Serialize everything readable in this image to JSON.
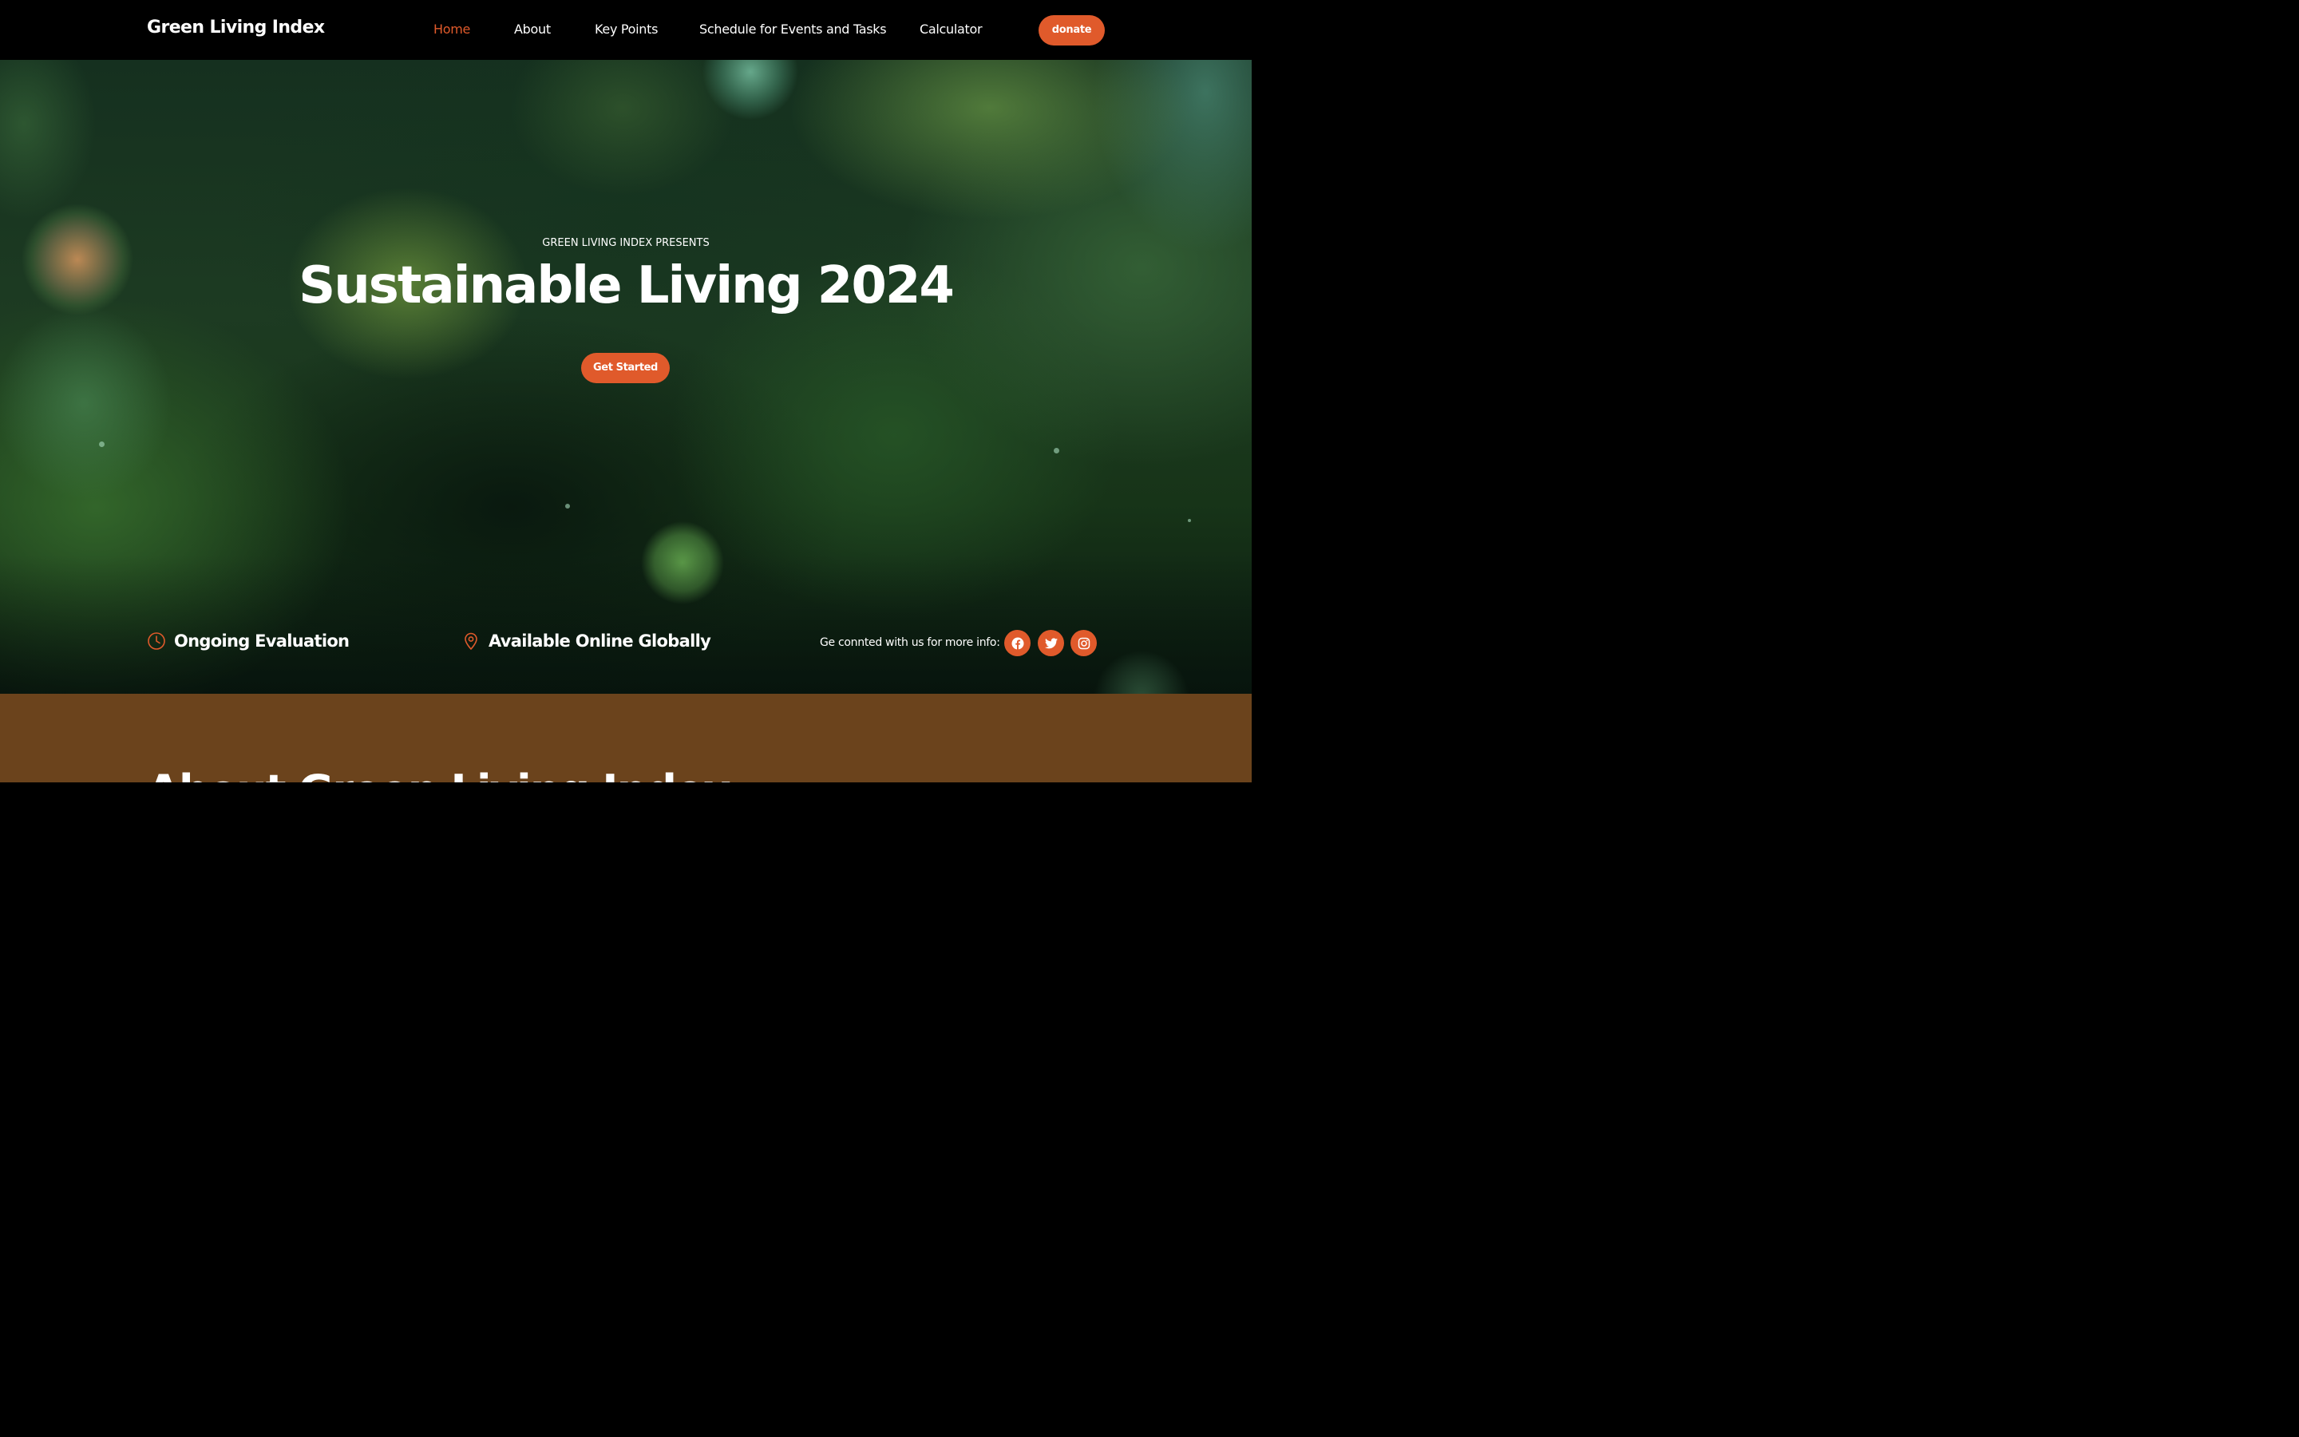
{
  "nav": {
    "brand": "Green Living Index",
    "links": [
      "Home",
      "About",
      "Key Points",
      "Schedule for Events and Tasks",
      "Calculator"
    ],
    "active": "Home",
    "donate": "donate"
  },
  "hero": {
    "eyebrow": "GREEN LIVING INDEX PRESENTS",
    "title": "Sustainable Living 2024",
    "cta": "Get Started",
    "info": [
      {
        "icon": "clock-icon",
        "text": "Ongoing Evaluation"
      },
      {
        "icon": "location-pin-icon",
        "text": "Available Online Globally"
      }
    ],
    "connect_label": "Ge connted with us for more info:",
    "social": [
      "facebook-icon",
      "twitter-icon",
      "instagram-icon"
    ]
  },
  "about": {
    "title": "About Green Living Index"
  },
  "colors": {
    "accent": "#e05a2b",
    "nav_bg": "#000000",
    "about_bg": "#6b431c"
  }
}
